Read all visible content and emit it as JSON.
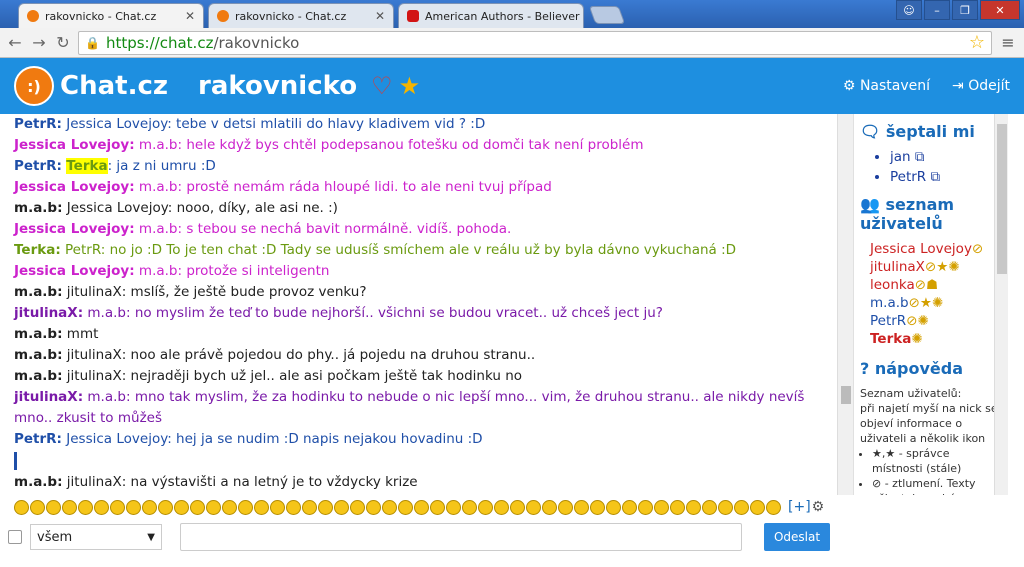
{
  "browser": {
    "tabs": [
      {
        "title": "rakovnicko - Chat.cz",
        "favicon_color": "#f07a10"
      },
      {
        "title": "rakovnicko - Chat.cz",
        "favicon_color": "#f07a10"
      },
      {
        "title": "American Authors - Believer",
        "favicon_color": "#d21414"
      }
    ],
    "url_scheme": "https://",
    "url_host": "chat.cz",
    "url_path": "/rakovnicko"
  },
  "header": {
    "logo_text": ":)",
    "brand": "Chat.cz",
    "room": "rakovnicko",
    "settings_label": "Nastavení",
    "logout_label": "Odejít",
    "accent": "#1e8fe0"
  },
  "messages": [
    {
      "user": "PetrR:",
      "text": " Jessica Lovejoy: tebe v detsi mlatili do hlavy kladivem vid ? :D",
      "cls": "c-petr"
    },
    {
      "user": "Jessica Lovejoy:",
      "text": " m.a.b: hele když bys chtěl podepsanou fotešku od domči tak není problém",
      "cls": "c-jess"
    },
    {
      "user": "PetrR:",
      "highlight": "Terka",
      "text": ": ja z ni umru :D",
      "cls": "c-petr"
    },
    {
      "user": "Jessica Lovejoy:",
      "text": " m.a.b: prostě nemám ráda hloupé lidi. to ale neni tvuj případ",
      "cls": "c-jess"
    },
    {
      "user": "m.a.b:",
      "text": " Jessica Lovejoy: nooo, díky, ale asi ne. :)",
      "cls": "c-mab"
    },
    {
      "user": "Jessica Lovejoy:",
      "text": " m.a.b: s tebou se nechá bavit normálně. vidíš. pohoda.",
      "cls": "c-jess"
    },
    {
      "user": "Terka:",
      "text": " PetrR: no jo :D To je ten chat :D Tady se udusíš smíchem ale v reálu už by byla dávno vykuchaná :D",
      "cls": "c-terka"
    },
    {
      "user": "Jessica Lovejoy:",
      "text": " m.a.b: protože si inteligentn",
      "cls": "c-jess"
    },
    {
      "user": "m.a.b:",
      "text": " jitulinaX: mslíš, že ještě bude provoz venku?",
      "cls": "c-mab"
    },
    {
      "user": "jitulinaX:",
      "text": " m.a.b: no myslim že teď to bude nejhorší.. všichni se budou vracet.. už chceš ject ju?",
      "cls": "c-jitu"
    },
    {
      "user": "m.a.b:",
      "text": " mmt",
      "cls": "c-mab"
    },
    {
      "user": "m.a.b:",
      "text": " jitulinaX: noo ale právě pojedou do phy.. já pojedu na druhou stranu..",
      "cls": "c-mab"
    },
    {
      "user": "m.a.b:",
      "text": " jitulinaX: nejraději bych už jel.. ale asi počkam ještě tak hodinku no",
      "cls": "c-mab"
    },
    {
      "user": "jitulinaX:",
      "text": " m.a.b: mno tak myslim, že za hodinku to nebude o nic lepší mno... vim, že druhou stranu.. ale nikdy nevíš mno.. zkusit to můžeš",
      "cls": "c-jitu"
    },
    {
      "user": "PetrR:",
      "text": " Jessica Lovejoy: hej ja se nudim :D napis nejakou hovadinu :D",
      "cls": "c-petr"
    },
    {
      "cursor": true
    },
    {
      "user": "m.a.b:",
      "text": " jitulinaX: na výstavišti a na letný je to vždycky krize",
      "cls": "c-mab"
    }
  ],
  "sidebar": {
    "whispers_title": "šeptali mi",
    "whispers": [
      "jan",
      "PetrR"
    ],
    "users_title": "seznam uživatelů",
    "users": [
      {
        "name": "Jessica Lovejoy",
        "cls": "u-jess",
        "icons": "⊘"
      },
      {
        "name": "jitulinaX",
        "cls": "u-jitu",
        "icons": "⊘★✺"
      },
      {
        "name": "leonka",
        "cls": "u-leon",
        "icons": "⊘☗"
      },
      {
        "name": "m.a.b",
        "cls": "u-mab",
        "icons": "⊘★✺"
      },
      {
        "name": "PetrR",
        "cls": "u-petr",
        "icons": "⊘✺"
      },
      {
        "name": "Terka",
        "cls": "u-terka",
        "icons": "✺"
      }
    ],
    "help_title": "nápověda",
    "help_intro": "Seznam uživatelů:\npři najetí myší na nick se objeví informace o uživateli a několik ikon",
    "help_items": [
      "★,★ - správce místnosti (stále)",
      "⊘ - ztlumení. Texty uživatele zmizí a neuvidíte ani jeho šeptání. Nick ztlumeného uživatele"
    ]
  },
  "input": {
    "target": "všem",
    "send_label": "Odeslat",
    "more_smileys": "[+]"
  }
}
